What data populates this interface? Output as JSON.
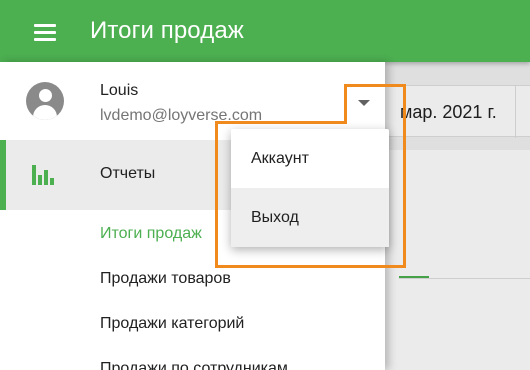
{
  "appbar": {
    "title": "Итоги продаж",
    "menu_icon": "hamburger-menu-icon"
  },
  "account": {
    "name": "Louis",
    "email": "lvdemo@loyverse.com",
    "avatar_icon": "account-circle-icon",
    "toggle_icon": "arrow-drop-down-icon"
  },
  "nav": {
    "reports": {
      "label": "Отчеты",
      "icon": "bar-chart-icon"
    },
    "sub_items": [
      {
        "label": "Итоги продаж",
        "active": true
      },
      {
        "label": "Продажи товаров",
        "active": false
      },
      {
        "label": "Продажи категорий",
        "active": false
      },
      {
        "label": "Продажи по сотрудникам",
        "active": false
      }
    ]
  },
  "background": {
    "date_text": "мар. 2021 г."
  },
  "popup_menu": {
    "items": [
      {
        "label": "Аккаунт"
      },
      {
        "label": "Выход"
      }
    ]
  },
  "colors": {
    "primary": "#4caf50",
    "highlight": "#f08a1c"
  }
}
